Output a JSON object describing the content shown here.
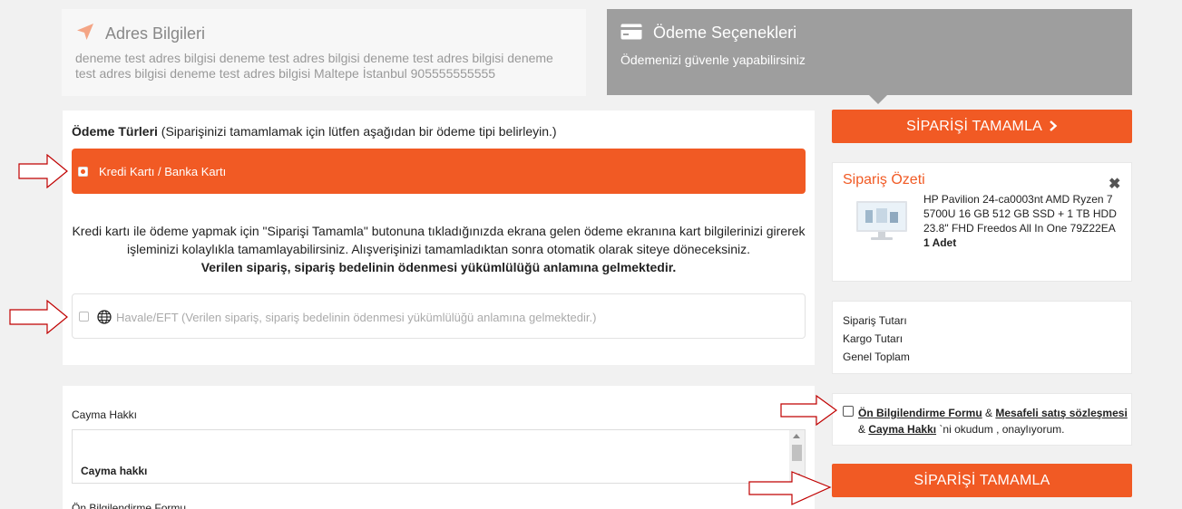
{
  "address": {
    "title": "Adres Bilgileri",
    "text": "deneme test adres bilgisi deneme test adres bilgisi deneme test adres bilgisi deneme test adres bilgisi deneme test adres bilgisi Maltepe İstanbul 905555555555"
  },
  "payment_header": {
    "title": "Ödeme Seçenekleri",
    "subtitle": "Ödemenizi güvenle yapabilirsiniz"
  },
  "payment_types": {
    "label_bold": "Ödeme Türleri",
    "label_rest": " (Siparişinizi tamamlamak için lütfen aşağıdan bir ödeme tipi belirleyin.)",
    "credit_card_label": "Kredi Kartı / Banka Kartı",
    "credit_card_desc": "Kredi kartı ile ödeme yapmak için \"Siparişi Tamamla\" butonuna tıkladığınızda ekrana gelen ödeme ekranına kart bilgilerinizi girerek işleminizi kolaylıkla tamamlayabilirsiniz. Alışverişinizi tamamladıktan sonra otomatik olarak siteye döneceksiniz.",
    "credit_card_note": "Verilen sipariş, sipariş bedelinin ödenmesi yükümlülüğü anlamına gelmektedir.",
    "havale_label": "Havale/EFT (Verilen sipariş, sipariş bedelinin ödenmesi yükümlülüğü anlamına gelmektedir.)"
  },
  "cayma": {
    "label": "Cayma Hakkı",
    "inner_title": "Cayma hakkı",
    "next_label": "Ön Bilgilendirme Formu"
  },
  "buttons": {
    "complete_top": "SİPARİŞİ TAMAMLA",
    "complete_top_icon": "chevron-right",
    "complete_bottom": "SİPARİŞİ TAMAMLA"
  },
  "summary": {
    "title": "Sipariş Özeti",
    "product_name": "HP Pavilion 24-ca0003nt AMD Ryzen 7 5700U 16 GB 512 GB SSD + 1 TB HDD 23.8\" FHD Freedos All In One 79Z22EA",
    "quantity": "1 Adet"
  },
  "totals": {
    "order_total": "Sipariş Tutarı",
    "shipping": "Kargo Tutarı",
    "grand_total": "Genel Toplam"
  },
  "agreement": {
    "link1": "Ön Bilgilendirme Formu",
    "sep1": " & ",
    "link2": "Mesafeli satış sözleşmesi",
    "sep2": " & ",
    "link3": "Cayma Hakkı",
    "suffix": " `ni okudum , onaylıyorum."
  },
  "colors": {
    "accent": "#f15a24",
    "header_gray": "#9e9e9e",
    "annotation": "#c00000"
  }
}
